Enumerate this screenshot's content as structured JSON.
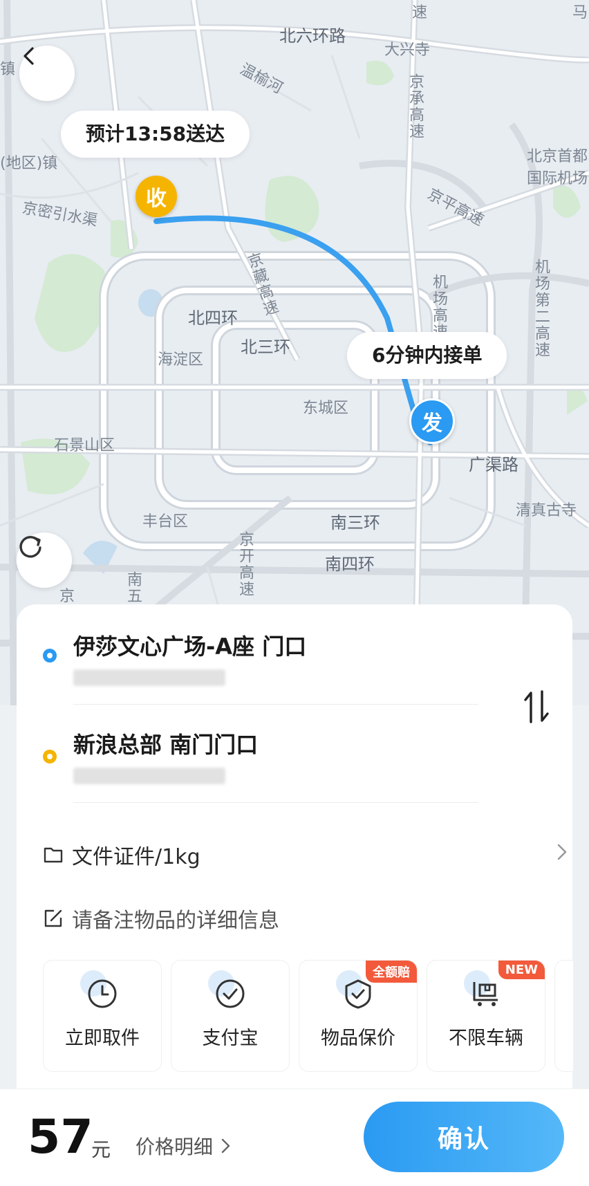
{
  "map": {
    "eta_bubble": "预计13:58送达",
    "pickup_bubble": "6分钟内接单",
    "receive_pin": "收",
    "send_pin": "发",
    "labels": {
      "north_6th_ring": "北六环路",
      "daxing_temple": "大兴寺",
      "wenyu_river": "温榆河",
      "jingcheng_expressway": "京承高速",
      "capital_airport": "北京首都",
      "capital_airport_2": "国际机场",
      "town_left": "镇",
      "district_town": "(地区)镇",
      "jingmi_canal": "京密引水渠",
      "jingping_expressway": "京平高速",
      "jingzang_expressway": "京藏高速",
      "airport_expressway": "机场高速",
      "airport_2nd_expressway": "机场第二高速",
      "north_4th_ring": "北四环",
      "north_3rd_ring": "北三环",
      "haidian": "海淀区",
      "dongcheng": "东城区",
      "shijingshan": "石景山区",
      "guangqu_road": "广渠路",
      "fengtai": "丰台区",
      "south_3rd_ring": "南三环",
      "qingzhen_temple": "清真古寺",
      "jingkai_expressway": "京开高速",
      "south_4th_ring": "南四环",
      "top_partial": "速",
      "top_right_partial": "马",
      "left_partial": "京",
      "south_partial": "南五"
    }
  },
  "sender": {
    "name": "伊莎文心广场-A座 门口"
  },
  "receiver": {
    "name": "新浪总部 南门门口"
  },
  "item": {
    "label": "文件证件/1kg"
  },
  "note": {
    "placeholder": "请备注物品的详细信息"
  },
  "services": [
    {
      "label": "立即取件",
      "icon": "clock-icon",
      "badge": ""
    },
    {
      "label": "支付宝",
      "icon": "check-circle-icon",
      "badge": ""
    },
    {
      "label": "物品保价",
      "icon": "shield-check-icon",
      "badge": "全额赔"
    },
    {
      "label": "不限车辆",
      "icon": "cart-icon",
      "badge": "NEW"
    }
  ],
  "footer": {
    "price": "57",
    "unit": "元",
    "price_detail": "价格明细",
    "confirm": "确认"
  },
  "colors": {
    "accent_blue": "#2a9af2",
    "pin_yellow": "#f5b400",
    "badge_red": "#f25a3b"
  }
}
